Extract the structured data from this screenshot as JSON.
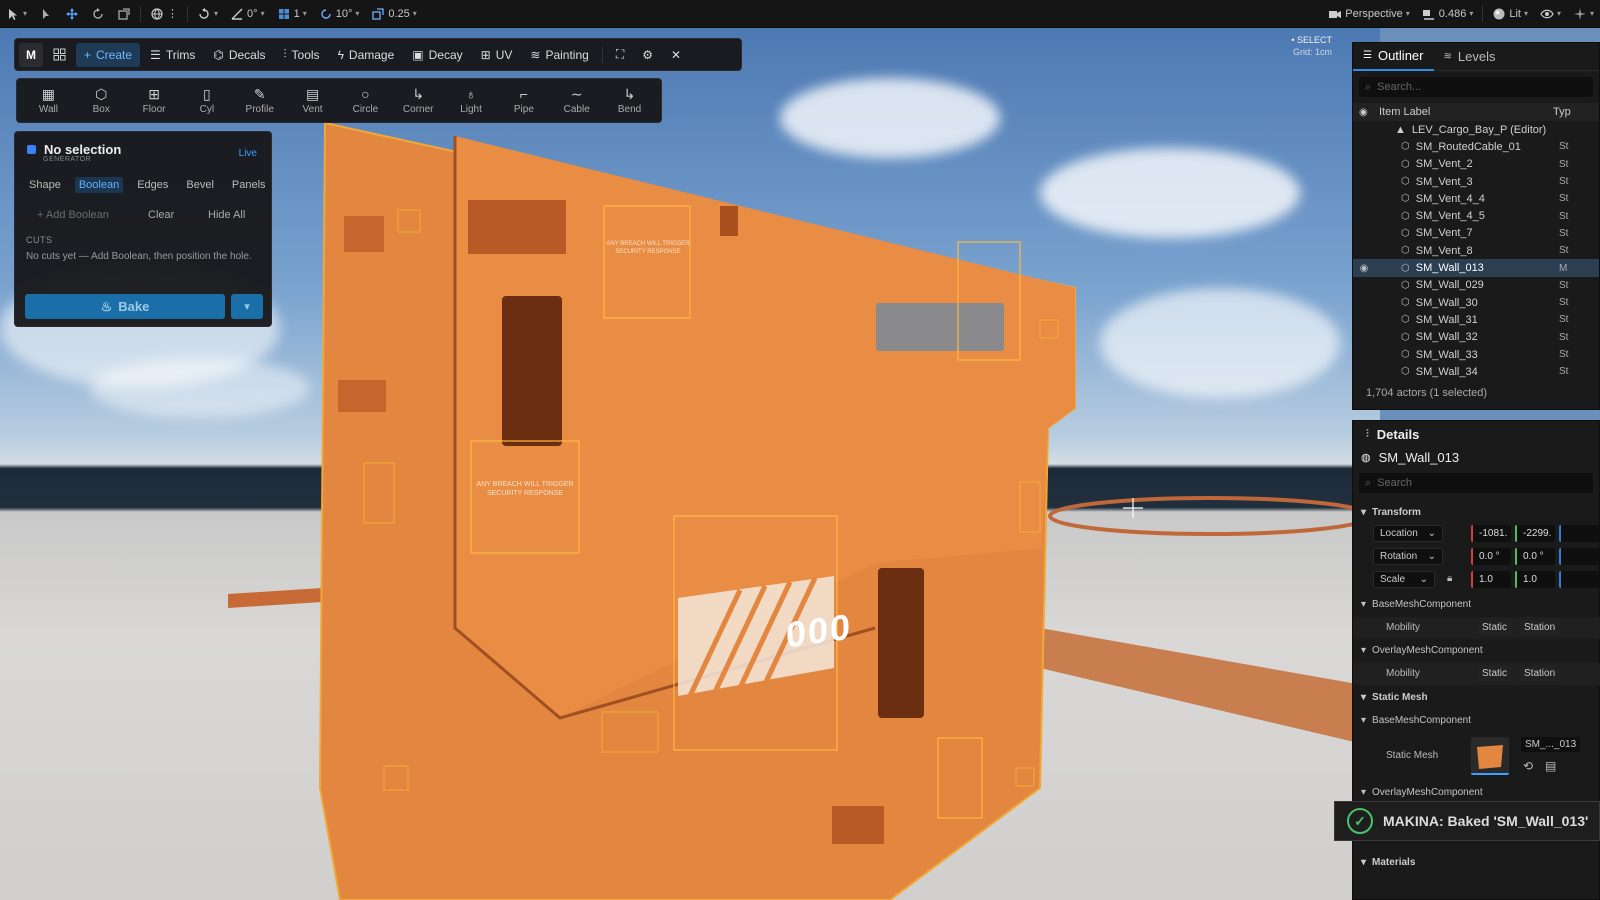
{
  "topbar": {
    "rotate_snap": "0°",
    "grid_snap": "1",
    "angle_snap": "10°",
    "scale_snap": "0.25",
    "view_mode": "Perspective",
    "camera_speed": "0.486",
    "lit_mode": "Lit"
  },
  "modebar": {
    "logo": "M",
    "items": [
      "Create",
      "Trims",
      "Decals",
      "Tools",
      "Damage",
      "Decay",
      "UV",
      "Painting"
    ]
  },
  "tools": [
    "Wall",
    "Box",
    "Floor",
    "Cyl",
    "Profile",
    "Vent",
    "Circle",
    "Corner",
    "Light",
    "Pipe",
    "Cable",
    "Bend"
  ],
  "selection_panel": {
    "title": "No selection",
    "subtitle": "GENERATOR",
    "live": "Live",
    "tabs": [
      "Shape",
      "Boolean",
      "Edges",
      "Bevel",
      "Panels"
    ],
    "add_boolean": "+ Add Boolean",
    "clear": "Clear",
    "hide_all": "Hide All",
    "cuts_header": "CUTS",
    "cuts_note": "No cuts yet — Add Boolean, then position the hole.",
    "bake": "Bake"
  },
  "viewport": {
    "select_label": "• SELECT",
    "grid_label": "Grid: 1cm",
    "decal_text": "ANY BREACH WILL TRIGGER SECURITY RESPONSE",
    "panel_number": "000"
  },
  "outliner": {
    "tab_outliner": "Outliner",
    "tab_levels": "Levels",
    "search_placeholder": "Search...",
    "col_label": "Item Label",
    "col_type": "Typ",
    "level": "LEV_Cargo_Bay_P (Editor)",
    "items": [
      {
        "name": "SM_RoutedCable_01",
        "type": "St"
      },
      {
        "name": "SM_Vent_2",
        "type": "St"
      },
      {
        "name": "SM_Vent_3",
        "type": "St"
      },
      {
        "name": "SM_Vent_4_4",
        "type": "St"
      },
      {
        "name": "SM_Vent_4_5",
        "type": "St"
      },
      {
        "name": "SM_Vent_7",
        "type": "St"
      },
      {
        "name": "SM_Vent_8",
        "type": "St"
      },
      {
        "name": "SM_Wall_013",
        "type": "M"
      },
      {
        "name": "SM_Wall_029",
        "type": "St"
      },
      {
        "name": "SM_Wall_30",
        "type": "St"
      },
      {
        "name": "SM_Wall_31",
        "type": "St"
      },
      {
        "name": "SM_Wall_32",
        "type": "St"
      },
      {
        "name": "SM_Wall_33",
        "type": "St"
      },
      {
        "name": "SM_Wall_34",
        "type": "St"
      }
    ],
    "footer": "1,704 actors (1 selected)"
  },
  "details": {
    "title": "Details",
    "object": "SM_Wall_013",
    "search_placeholder": "Search",
    "transform": "Transform",
    "location": "Location",
    "rotation": "Rotation",
    "scale": "Scale",
    "loc_x": "-1081.",
    "loc_y": "-2299.",
    "rot_x": "0.0 °",
    "rot_y": "0.0 °",
    "scale_x": "1.0",
    "scale_y": "1.0",
    "base_mesh_component": "BaseMeshComponent",
    "overlay_mesh_component": "OverlayMeshComponent",
    "mobility": "Mobility",
    "static": "Static",
    "stationary": "Station",
    "static_mesh_section": "Static Mesh",
    "static_mesh_label": "Static Mesh",
    "mesh_ref": "SM_..._013",
    "materials": "Materials"
  },
  "toast": {
    "message": "MAKINA: Baked 'SM_Wall_013'"
  }
}
